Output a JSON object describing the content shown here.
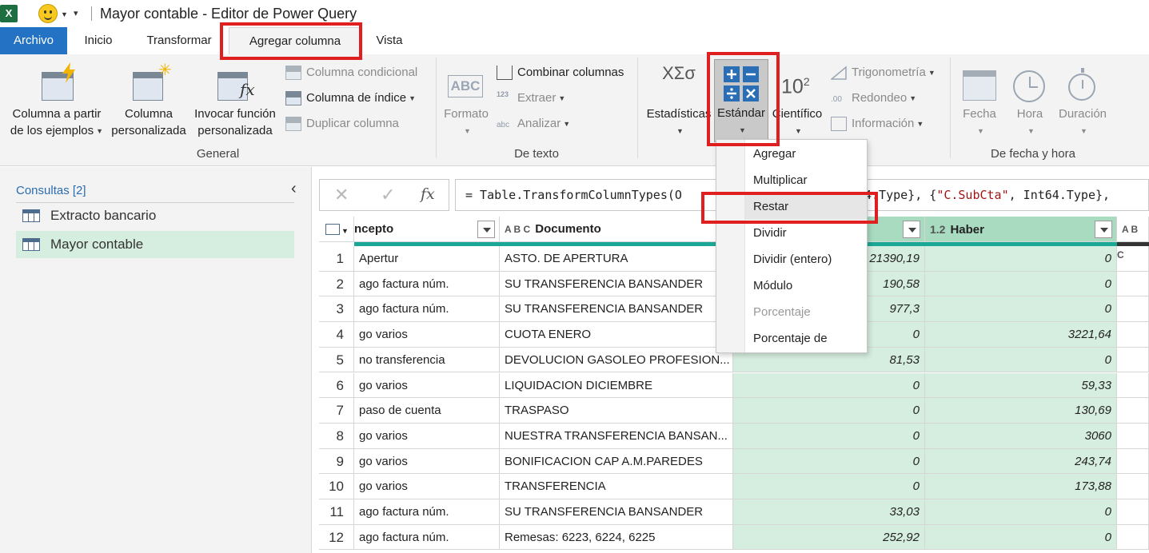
{
  "window": {
    "title": "Mayor contable - Editor de Power Query",
    "app_icon": "X"
  },
  "tabs": [
    {
      "label": "Archivo"
    },
    {
      "label": "Inicio"
    },
    {
      "label": "Transformar"
    },
    {
      "label": "Agregar columna"
    },
    {
      "label": "Vista"
    }
  ],
  "ribbon": {
    "general": {
      "label": "General",
      "col_from_examples_1": "Columna a partir",
      "col_from_examples_2": "de los ejemplos",
      "custom_col_1": "Columna",
      "custom_col_2": "personalizada",
      "invoke_fn_1": "Invocar función",
      "invoke_fn_2": "personalizada",
      "conditional": "Columna condicional",
      "index": "Columna de índice",
      "duplicate": "Duplicar columna"
    },
    "text": {
      "label": "De texto",
      "format": "Formato",
      "merge": "Combinar columnas",
      "extract": "Extraer",
      "parse": "Analizar",
      "abc_icon": "ABC",
      "num_icon": "123"
    },
    "number": {
      "statistics": "Estadísticas",
      "standard": "Estándar",
      "scientific": "Científico",
      "sci_icon": "10",
      "sci_exp": "2",
      "stat_icon": "XΣσ",
      "trig": "Trigonometría",
      "rounding": "Redondeo",
      "info": "Información",
      "round_icon": ".00"
    },
    "datetime": {
      "label": "De fecha y hora",
      "date": "Fecha",
      "time": "Hora",
      "duration": "Duración"
    }
  },
  "queries": {
    "header": "Consultas [2]",
    "items": [
      {
        "label": "Extracto bancario"
      },
      {
        "label": "Mayor contable"
      }
    ]
  },
  "formula_bar": {
    "prefix": "= Table.TransformColumnTypes(O",
    "mid": "t64.Type}, {",
    "str": "\"C.SubCta\"",
    "suffix": ", Int64.Type},"
  },
  "table": {
    "columns": {
      "concepto": "ncepto",
      "documento": "Documento",
      "haber": "Haber",
      "haber_type": "1.2",
      "text_type": "A B C"
    },
    "rows": [
      {
        "n": "1",
        "concepto": "Apertur",
        "documento": "ASTO. DE APERTURA",
        "debe": "21390,19",
        "haber": "0"
      },
      {
        "n": "2",
        "concepto": "ago factura núm.",
        "documento": "SU TRANSFERENCIA BANSANDER",
        "debe": "190,58",
        "haber": "0"
      },
      {
        "n": "3",
        "concepto": "ago factura núm.",
        "documento": "SU TRANSFERENCIA BANSANDER",
        "debe": "977,3",
        "haber": "0"
      },
      {
        "n": "4",
        "concepto": "go varios",
        "documento": "CUOTA ENERO",
        "debe": "0",
        "haber": "3221,64"
      },
      {
        "n": "5",
        "concepto": "no transferencia",
        "documento": "DEVOLUCION GASOLEO PROFESION...",
        "debe": "81,53",
        "haber": "0"
      },
      {
        "n": "6",
        "concepto": "go varios",
        "documento": "LIQUIDACION DICIEMBRE",
        "debe": "0",
        "haber": "59,33"
      },
      {
        "n": "7",
        "concepto": "paso de cuenta",
        "documento": "TRASPASO",
        "debe": "0",
        "haber": "130,69"
      },
      {
        "n": "8",
        "concepto": "go varios",
        "documento": "NUESTRA TRANSFERENCIA BANSAN...",
        "debe": "0",
        "haber": "3060"
      },
      {
        "n": "9",
        "concepto": "go varios",
        "documento": "BONIFICACION CAP A.M.PAREDES",
        "debe": "0",
        "haber": "243,74"
      },
      {
        "n": "10",
        "concepto": "go varios",
        "documento": "TRANSFERENCIA",
        "debe": "0",
        "haber": "173,88"
      },
      {
        "n": "11",
        "concepto": "ago factura núm.",
        "documento": "SU TRANSFERENCIA BANSANDER",
        "debe": "33,03",
        "haber": "0"
      },
      {
        "n": "12",
        "concepto": "ago factura núm.",
        "documento": "Remesas: 6223, 6224, 6225",
        "debe": "252,92",
        "haber": "0"
      }
    ]
  },
  "menu": {
    "items": [
      {
        "label": "Agregar",
        "enabled": true
      },
      {
        "label": "Multiplicar",
        "enabled": true
      },
      {
        "label": "Restar",
        "enabled": true
      },
      {
        "label": "Dividir",
        "enabled": true
      },
      {
        "label": "Dividir (entero)",
        "enabled": true
      },
      {
        "label": "Módulo",
        "enabled": true
      },
      {
        "label": "Porcentaje",
        "enabled": false
      },
      {
        "label": "Porcentaje de",
        "enabled": true
      }
    ]
  },
  "colors": {
    "accent": "#2372c4",
    "selected_col": "#d6eedf",
    "highlight": "#e02020"
  }
}
